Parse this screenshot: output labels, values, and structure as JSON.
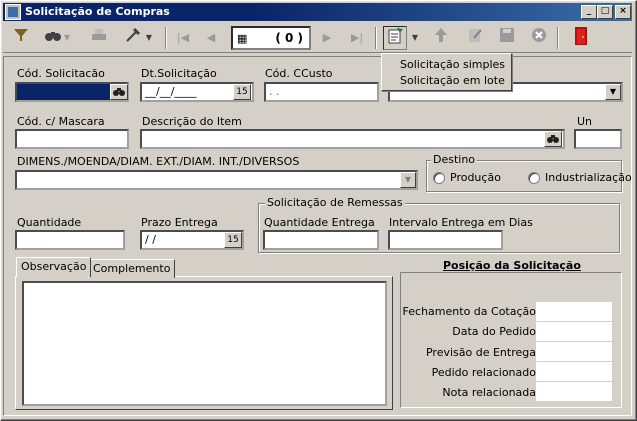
{
  "window": {
    "title": "Solicitação de Compras",
    "minimize": "_",
    "maximize": "□",
    "close": "×"
  },
  "toolbar": {
    "counter_icon": "▦",
    "counter_value": "( 0 )"
  },
  "menu": {
    "items": [
      "Solicitação simples",
      "Solicitação em lote"
    ]
  },
  "form": {
    "cod_solicitacao_label": "Cód. Solicitacão",
    "dt_solicitacao_label": "Dt.Solicitação",
    "dt_solicitacao_value": "__/__/____",
    "cod_ccusto_label": "Cód. CCusto",
    "cod_ccusto_value": "  .    .",
    "cod_mascara_label": "Cód. c/ Mascara",
    "descricao_label": "Descrição do Item",
    "un_label": "Un",
    "dimens_label": "DIMENS./MOENDA/DIAM. EXT./DIAM. INT./DIVERSOS",
    "destino_label": "Destino",
    "producao_label": "Produção",
    "industrializacao_label": "Industrialização",
    "quantidade_label": "Quantidade",
    "prazo_label": "Prazo Entrega",
    "prazo_value": " / /",
    "remessas_label": "Solicitação de Remessas",
    "qtd_entrega_label": "Quantidade Entrega",
    "intervalo_label": "Intervalo Entrega em Dias",
    "cal_button": "15"
  },
  "tabs": {
    "observacao": "Observação",
    "complemento": "Complemento"
  },
  "posicao": {
    "title": "Posição da Solicitação",
    "rows": [
      "Fechamento da Cotação",
      "Data do Pedido",
      "Previsão de Entrega",
      "Pedido relacionado",
      "Nota relacionada"
    ]
  },
  "colors": {
    "title_bar": "#0a246a",
    "face": "#d4d0c8",
    "selected_field": "#0a246a"
  }
}
